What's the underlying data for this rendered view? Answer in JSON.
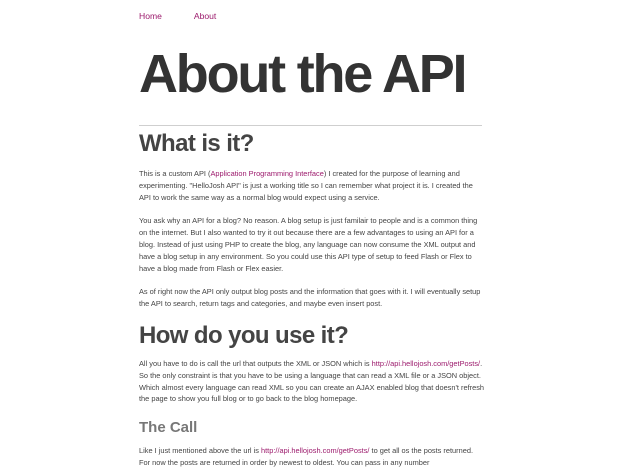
{
  "nav": {
    "home": "Home",
    "about": "About"
  },
  "title": "About the API",
  "sections": {
    "what": {
      "heading": "What is it?",
      "p1_a": "This is a custom API (",
      "p1_link": "Application Programming Interface",
      "p1_b": ") I created for the purpose of learning and experimenting. \"HelloJosh API\" is just a working title so I can remember what project it is. I created the API to work the same way as a normal blog would expect using a service.",
      "p2": "You ask why an API for a blog? No reason. A blog setup is just familair to people and is a common thing on the internet. But I also wanted to try it out because there are a few advantages to using an API for a blog. Instead of just using PHP to create the blog, any language can now consume the XML output and have a blog setup in any environment. So you could use this API type of setup to feed Flash or Flex to have a blog made from Flash or Flex easier.",
      "p3": "As of right now the API only output blog posts and the information that goes with it. I will eventually setup the API to search, return tags and categories, and maybe even insert post."
    },
    "how": {
      "heading": "How do you use it?",
      "p1_a": "All you have to do is call the url that outputs the XML or JSON which is ",
      "p1_link": "http://api.hellojosh.com/getPosts/",
      "p1_b": ". So the only constraint is that you have to be using a language that can read a XML file or a JSON object. Which almost every language can read XML so you can create an AJAX enabled blog that doesn't refresh the page to show you full blog or to go back to the blog homepage."
    },
    "call": {
      "heading": "The Call",
      "p1_a": "Like I just mentioned above the url is ",
      "p1_link": "http://api.hellojosh.com/getPosts/",
      "p1_b": " to get all os the posts returned. For now the posts are returned in order by newest to oldest. You can pass in any number"
    }
  }
}
